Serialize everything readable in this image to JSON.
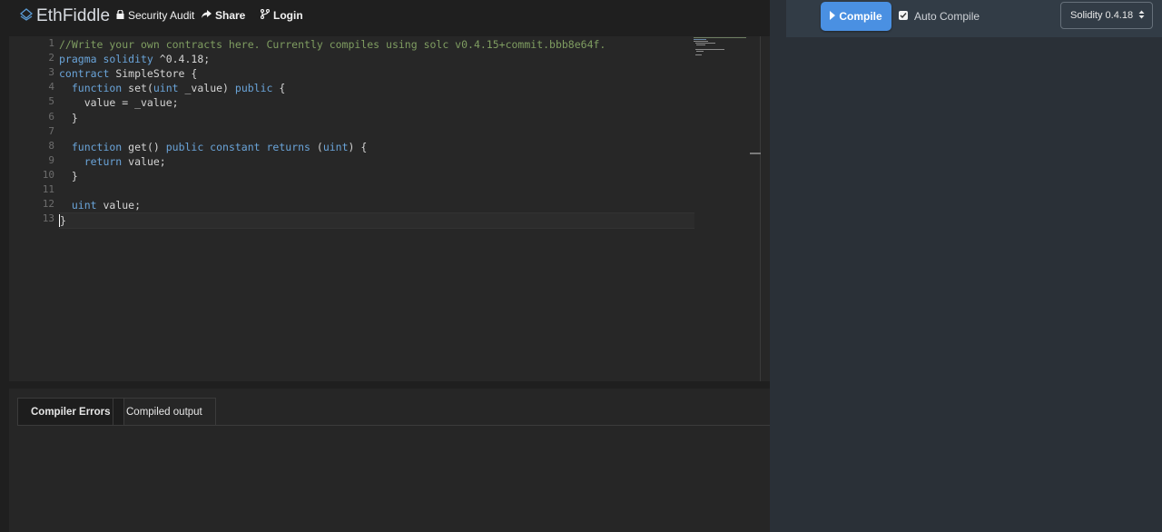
{
  "brand": {
    "name": "EthFiddle",
    "icon": "ethfiddle-logo-icon"
  },
  "nav": {
    "security_audit": {
      "label": "Security Audit",
      "icon": "lock-icon"
    },
    "share": {
      "label": "Share",
      "icon": "share-icon"
    },
    "login": {
      "label": "Login",
      "icon": "git-branch-icon"
    }
  },
  "editor": {
    "line_numbers": [
      "1",
      "2",
      "3",
      "4",
      "5",
      "6",
      "7",
      "8",
      "9",
      "10",
      "11",
      "12",
      "13"
    ],
    "lines": [
      [
        {
          "t": "//Write your own contracts here. Currently compiles using solc v0.4.15+commit.bbb8e64f.",
          "c": "comment"
        }
      ],
      [
        {
          "t": "pragma solidity",
          "c": "kw"
        },
        {
          "t": " ^0.4.18;",
          "c": ""
        }
      ],
      [
        {
          "t": "contract",
          "c": "kw"
        },
        {
          "t": " SimpleStore {",
          "c": ""
        }
      ],
      [
        {
          "t": "  function",
          "c": "kw"
        },
        {
          "t": " set(",
          "c": ""
        },
        {
          "t": "uint",
          "c": "kw"
        },
        {
          "t": " _value) ",
          "c": ""
        },
        {
          "t": "public",
          "c": "kw"
        },
        {
          "t": " {",
          "c": ""
        }
      ],
      [
        {
          "t": "    value = _value;",
          "c": ""
        }
      ],
      [
        {
          "t": "  }",
          "c": ""
        }
      ],
      [
        {
          "t": "",
          "c": ""
        }
      ],
      [
        {
          "t": "  function",
          "c": "kw"
        },
        {
          "t": " get() ",
          "c": ""
        },
        {
          "t": "public constant returns",
          "c": "kw"
        },
        {
          "t": " (",
          "c": ""
        },
        {
          "t": "uint",
          "c": "kw"
        },
        {
          "t": ") {",
          "c": ""
        }
      ],
      [
        {
          "t": "    return",
          "c": "kw"
        },
        {
          "t": " value;",
          "c": ""
        }
      ],
      [
        {
          "t": "  }",
          "c": ""
        }
      ],
      [
        {
          "t": "",
          "c": ""
        }
      ],
      [
        {
          "t": "  uint",
          "c": "kw"
        },
        {
          "t": " value;",
          "c": ""
        }
      ],
      [
        {
          "t": "}",
          "c": ""
        }
      ]
    ],
    "active_line": 13
  },
  "output_tabs": {
    "errors": "Compiler Errors",
    "output": "Compiled output",
    "active": "errors"
  },
  "toolbar": {
    "compile_label": "Compile",
    "auto_compile_label": "Auto Compile",
    "auto_compile_checked": true,
    "solc_version": "Solidity 0.4.18"
  },
  "colors": {
    "accent": "#4a90e2",
    "comment": "#7f9d61",
    "keyword": "#6aa4d9",
    "right_panel": "#2a3037"
  }
}
